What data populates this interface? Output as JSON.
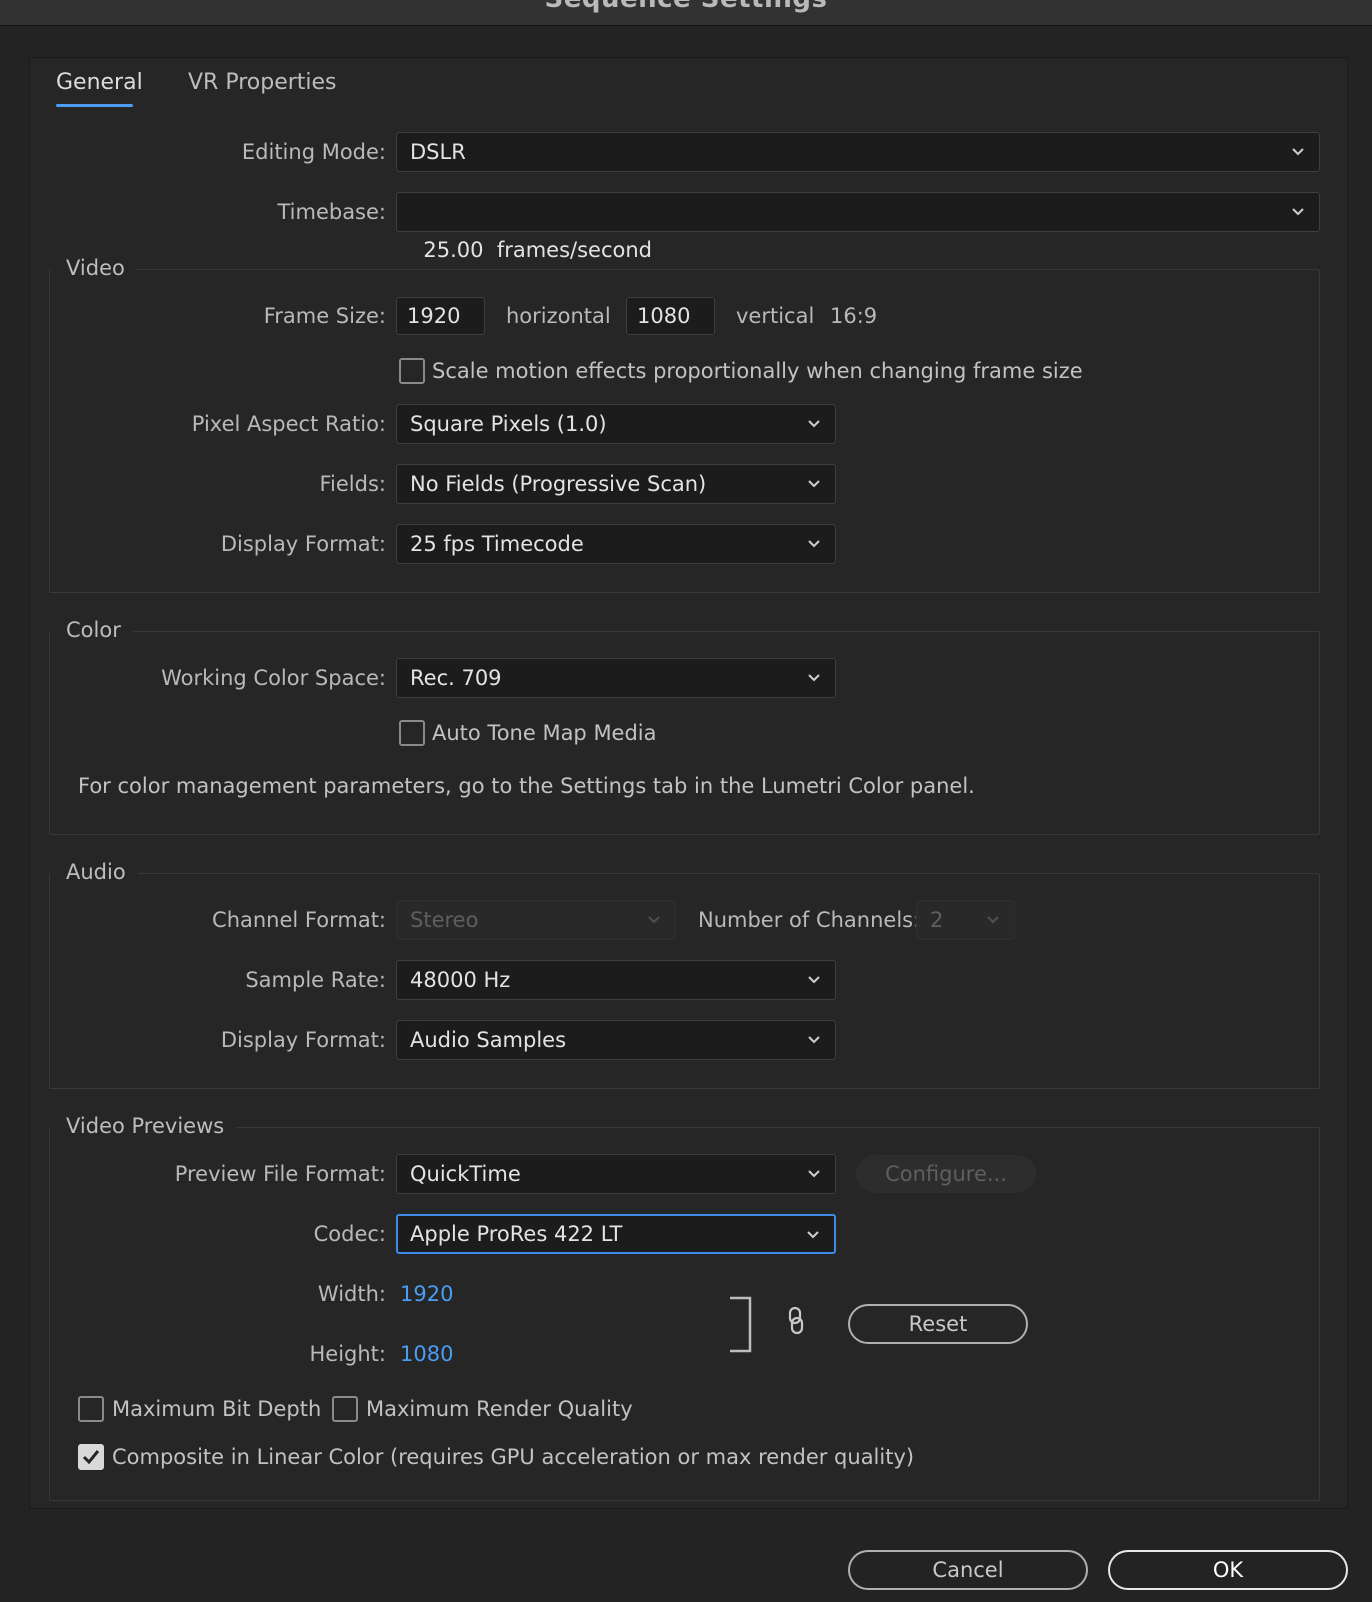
{
  "window": {
    "title": "Sequence Settings"
  },
  "tabs": [
    {
      "label": "General",
      "active": true
    },
    {
      "label": "VR Properties",
      "active": false
    }
  ],
  "general": {
    "editing_mode": {
      "label": "Editing Mode:",
      "value": "DSLR"
    },
    "timebase": {
      "label": "Timebase:",
      "value": "25.00  frames/second"
    }
  },
  "video": {
    "title": "Video",
    "frame_size": {
      "label": "Frame Size:",
      "horizontal": "1920",
      "horizontal_label": "horizontal",
      "vertical": "1080",
      "vertical_label": "vertical",
      "aspect": "16:9"
    },
    "scale_motion": {
      "label": "Scale motion effects proportionally when changing frame size",
      "checked": false
    },
    "pixel_aspect": {
      "label": "Pixel Aspect Ratio:",
      "value": "Square Pixels (1.0)"
    },
    "fields": {
      "label": "Fields:",
      "value": "No Fields (Progressive Scan)"
    },
    "display_format": {
      "label": "Display Format:",
      "value": "25 fps Timecode"
    }
  },
  "color": {
    "title": "Color",
    "working_space": {
      "label": "Working Color Space:",
      "value": "Rec. 709"
    },
    "auto_tone_map": {
      "label": "Auto Tone Map Media",
      "checked": false
    },
    "note": "For color management parameters, go to the Settings tab in the Lumetri Color panel."
  },
  "audio": {
    "title": "Audio",
    "channel_format": {
      "label": "Channel Format:",
      "value": "Stereo",
      "disabled": true
    },
    "num_channels": {
      "label": "Number of Channels:",
      "value": "2",
      "disabled": true
    },
    "sample_rate": {
      "label": "Sample Rate:",
      "value": "48000 Hz"
    },
    "display_format": {
      "label": "Display Format:",
      "value": "Audio Samples"
    }
  },
  "previews": {
    "title": "Video Previews",
    "file_format": {
      "label": "Preview File Format:",
      "value": "QuickTime"
    },
    "configure_label": "Configure...",
    "codec": {
      "label": "Codec:",
      "value": "Apple ProRes 422 LT"
    },
    "width": {
      "label": "Width:",
      "value": "1920"
    },
    "height": {
      "label": "Height:",
      "value": "1080"
    },
    "reset_label": "Reset",
    "max_bit_depth": {
      "label": "Maximum Bit Depth",
      "checked": false
    },
    "max_render_quality": {
      "label": "Maximum Render Quality",
      "checked": false
    },
    "composite_linear": {
      "label": "Composite in Linear Color (requires GPU acceleration or max render quality)",
      "checked": true
    }
  },
  "footer": {
    "cancel_label": "Cancel",
    "ok_label": "OK"
  },
  "colors": {
    "accent": "#4b9cf5",
    "background": "#232323",
    "panel": "#262626"
  },
  "icons": {
    "dropdown": "chevron-down-icon",
    "link": "link-icon",
    "check": "checkmark-icon"
  }
}
